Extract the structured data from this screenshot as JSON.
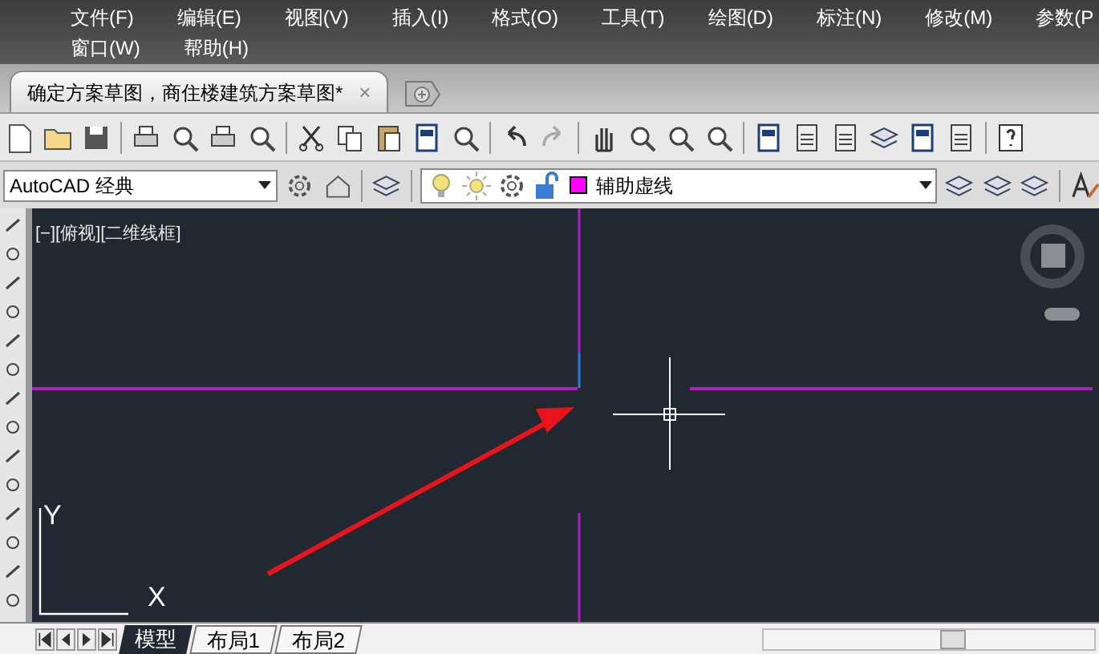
{
  "menu_bar": {
    "rows": [
      [
        "文件(F)",
        "编辑(E)",
        "视图(V)",
        "插入(I)",
        "格式(O)",
        "工具(T)",
        "绘图(D)",
        "标注(N)",
        "修改(M)",
        "参数(P"
      ],
      [
        "窗口(W)",
        "帮助(H)"
      ]
    ]
  },
  "document_tabs": [
    {
      "label": "确定方案草图，商住楼建筑方案草图*",
      "selected": true,
      "close": "×"
    }
  ],
  "workspace": {
    "value": "AutoCAD 经典"
  },
  "layer": {
    "value": "辅助虚线",
    "color": "#ff00ff"
  },
  "viewport": {
    "label": "[−][俯视][二维线框]",
    "ucs_x": "X",
    "ucs_y": "Y"
  },
  "layout_tabs": [
    {
      "label": "模型",
      "selected": true
    },
    {
      "label": "布局1",
      "selected": false
    },
    {
      "label": "布局2",
      "selected": false
    }
  ]
}
